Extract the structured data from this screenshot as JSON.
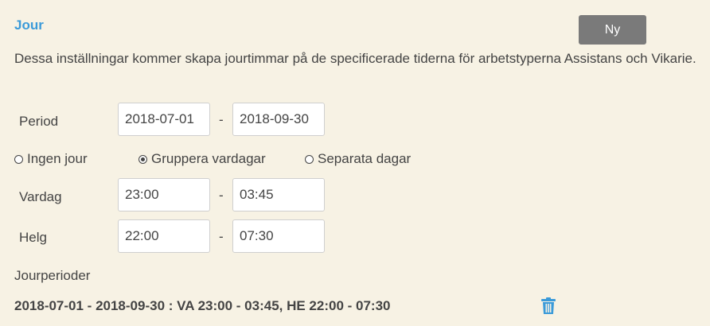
{
  "section": {
    "title": "Jour",
    "new_button": "Ny",
    "description": "Dessa inställningar kommer skapa jourtimmar på de specificerade tiderna för arbetstyperna Assistans och Vikarie."
  },
  "period": {
    "label": "Period",
    "from": "2018-07-01",
    "to": "2018-09-30",
    "separator": "-"
  },
  "options": [
    {
      "label": "Ingen jour",
      "selected": false
    },
    {
      "label": "Gruppera vardagar",
      "selected": true
    },
    {
      "label": "Separata dagar",
      "selected": false
    }
  ],
  "weekday": {
    "label": "Vardag",
    "from": "23:00",
    "to": "03:45",
    "separator": "-"
  },
  "weekend": {
    "label": "Helg",
    "from": "22:00",
    "to": "07:30",
    "separator": "-"
  },
  "periods_list": {
    "label": "Jourperioder",
    "items": [
      {
        "text": "2018-07-01 - 2018-09-30 : VA 23:00 - 03:45, HE 22:00 - 07:30",
        "icon": "trash-icon"
      }
    ]
  },
  "colors": {
    "background": "#f7f2e4",
    "accent": "#3a9ad9",
    "button": "#7a7a7a",
    "text": "#444444"
  }
}
